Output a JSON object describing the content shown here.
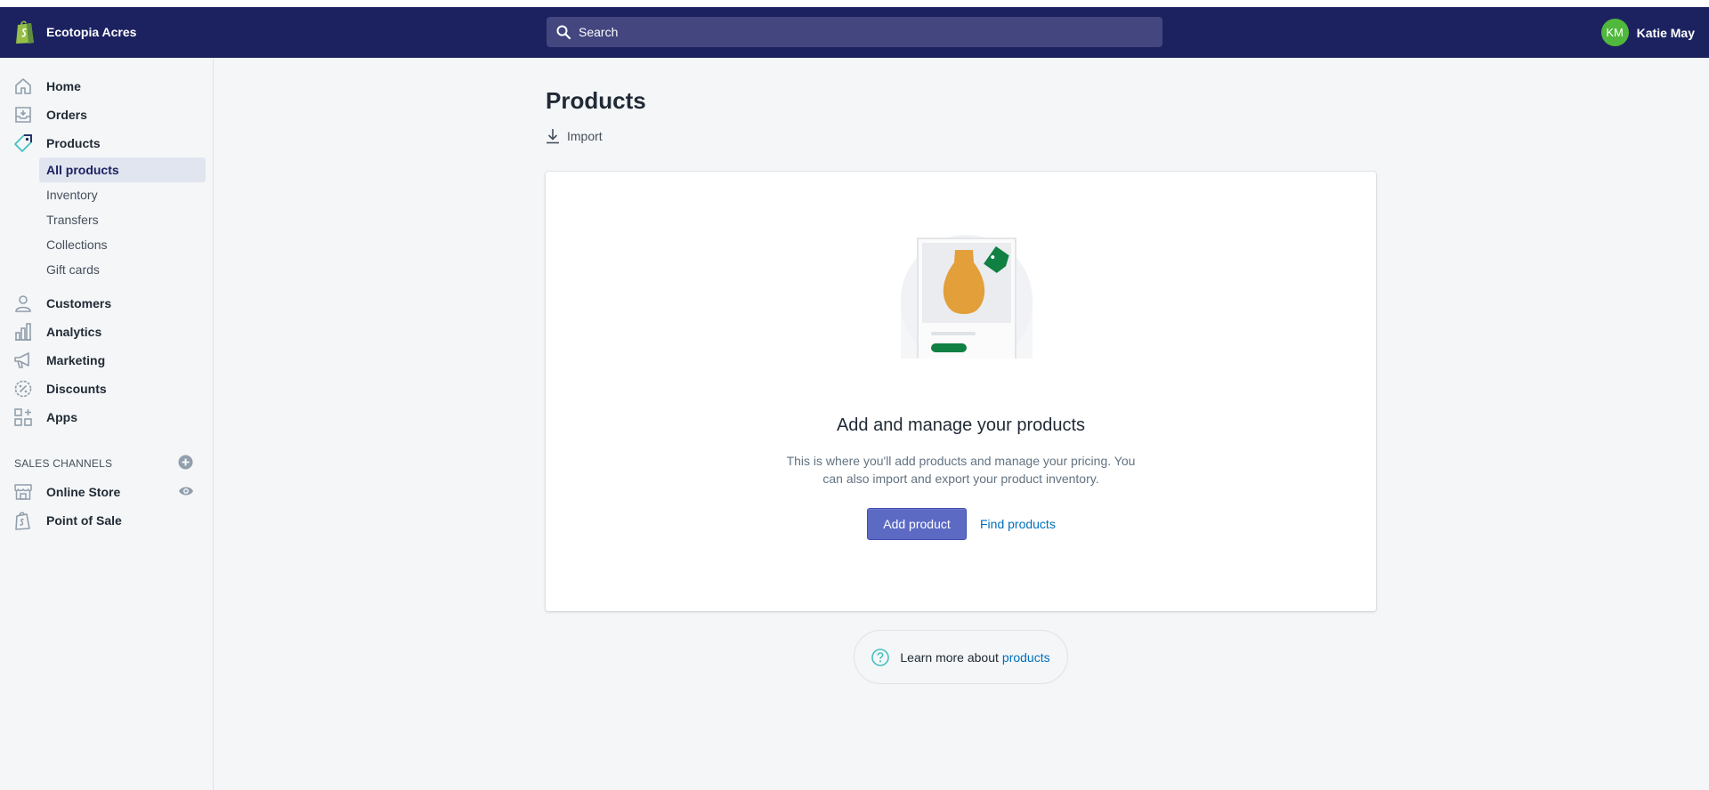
{
  "app": {
    "store_name": "Ecotopia Acres",
    "search_placeholder": "Search",
    "user_initials": "KM",
    "user_name": "Katie May",
    "accent_color": "#5c6ac4",
    "topbar_color": "#1c2260"
  },
  "sidebar": {
    "items": [
      {
        "label": "Home",
        "icon": "home-icon"
      },
      {
        "label": "Orders",
        "icon": "orders-icon"
      },
      {
        "label": "Products",
        "icon": "tag-icon"
      },
      {
        "label": "Customers",
        "icon": "customer-icon"
      },
      {
        "label": "Analytics",
        "icon": "analytics-icon"
      },
      {
        "label": "Marketing",
        "icon": "megaphone-icon"
      },
      {
        "label": "Discounts",
        "icon": "discount-icon"
      },
      {
        "label": "Apps",
        "icon": "apps-icon"
      }
    ],
    "product_subitems": [
      "All products",
      "Inventory",
      "Transfers",
      "Collections",
      "Gift cards"
    ],
    "channels_title": "SALES CHANNELS",
    "channels": [
      {
        "label": "Online Store",
        "icon": "store-icon"
      },
      {
        "label": "Point of Sale",
        "icon": "pos-icon"
      }
    ]
  },
  "main": {
    "title": "Products",
    "import_label": "Import",
    "empty_title": "Add and manage your products",
    "empty_description": "This is where you'll add products and manage your pricing. You can also import and export your product inventory.",
    "add_button": "Add product",
    "find_link": "Find products",
    "learn_prefix": "Learn more about",
    "learn_link": "products"
  }
}
